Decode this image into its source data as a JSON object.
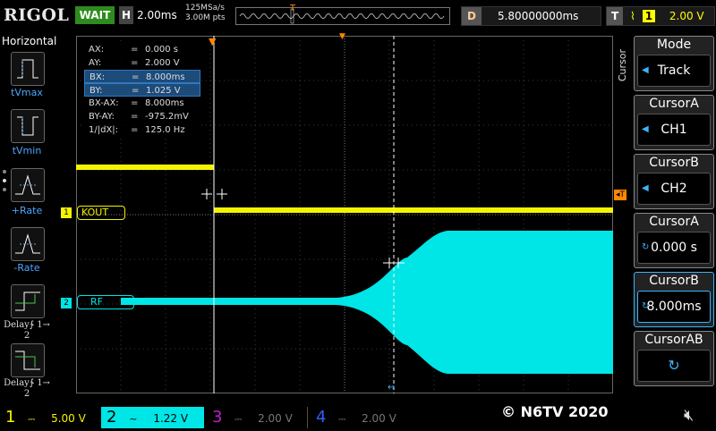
{
  "top": {
    "logo": "RIGOL",
    "status": "WAIT",
    "h_key": "H",
    "timebase": "2.00ms",
    "sample_rate": "125MSa/s",
    "memory_depth": "3.00M pts",
    "delay_key": "D",
    "delay_value": "5.80000000ms",
    "trigger_key": "T",
    "trigger_channel": "1",
    "trigger_level": "2.00 V"
  },
  "left": {
    "title": "Horizontal",
    "items": [
      {
        "label": "tVmax"
      },
      {
        "label": "tVmin"
      },
      {
        "label": "+Rate"
      },
      {
        "label": "-Rate"
      },
      {
        "label": "Delay∱ 1→ 2"
      },
      {
        "label": "Delay∱ 1→ 2"
      }
    ]
  },
  "measurements": {
    "rows": [
      {
        "label": "AX:",
        "value": "0.000 s",
        "highlight": false
      },
      {
        "label": "AY:",
        "value": "2.000 V",
        "highlight": false
      },
      {
        "label": "BX:",
        "value": "8.000ms",
        "highlight": true
      },
      {
        "label": "BY:",
        "value": "1.025 V",
        "highlight": true
      },
      {
        "label": "BX-AX:",
        "value": "8.000ms",
        "highlight": false
      },
      {
        "label": "BY-AY:",
        "value": "-975.2mV",
        "highlight": false
      },
      {
        "label": "1/|dX|:",
        "value": "125.0 Hz",
        "highlight": false
      }
    ]
  },
  "channels": {
    "ch1_label": "KOUT",
    "ch2_label": "RF"
  },
  "menu": {
    "side_label": "Cursor",
    "buttons": [
      {
        "title": "Mode",
        "value": "Track"
      },
      {
        "title": "CursorA",
        "value": "CH1"
      },
      {
        "title": "CursorB",
        "value": "CH2"
      },
      {
        "title": "CursorA",
        "value": "0.000 s"
      },
      {
        "title": "CursorB",
        "value": "8.000ms"
      },
      {
        "title": "CursorAB",
        "value": ""
      }
    ]
  },
  "bottom": {
    "ch1": {
      "num": "1",
      "scale": "5.00 V"
    },
    "ch2": {
      "num": "2",
      "scale": "1.22 V"
    },
    "ch3": {
      "num": "3",
      "scale": "2.00 V"
    },
    "ch4": {
      "num": "4",
      "scale": "2.00 V"
    },
    "copyright": "© N6TV 2020"
  },
  "colors": {
    "ch1": "#f4f400",
    "ch2": "#00e5e5",
    "ch3": "#c020c0",
    "ch4": "#3060ff",
    "accent": "#3ab4ff",
    "trigger": "#ff8800"
  }
}
